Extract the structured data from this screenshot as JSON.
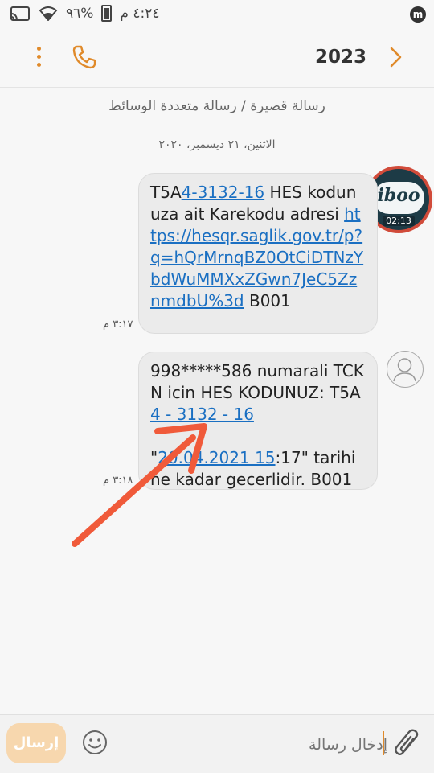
{
  "status_bar": {
    "time": "٤:٢٤ م",
    "battery": "%٩٦"
  },
  "header": {
    "title": "2023"
  },
  "conversation": {
    "type_label": "رسالة قصيرة / رسالة متعددة الوسائط",
    "date_label": "الاثنين، ٢١ ديسمبر، ٢٠٢٠"
  },
  "messages": [
    {
      "parts": [
        "T5A",
        "4-3132-16",
        " HES kodunuza ait Karekodu adresi ",
        "https://hesqr.saglik.gov.tr/p?q=hQrMrnqBZ0OtCiDTNzYbdWuMMXxZGwn7JeC5ZznmdbU%3d",
        " B001"
      ],
      "time": "٣:١٧ م"
    },
    {
      "parts": [
        "998*****586 numarali TCKN icin HES KODUNUZ: T5A",
        "4 - 3132 - 16",
        "\"",
        "20.04.2021 15",
        ":17\" tarihine kadar gecerlidir. B001"
      ],
      "time": "٣:١٨ م"
    }
  ],
  "avatar": {
    "logo_text": "iboo",
    "duration": "02:13"
  },
  "input_bar": {
    "placeholder": "إدخال رسالة",
    "send_label": "إرسال"
  },
  "colors": {
    "accent": "#e08a2a",
    "link": "#1a6fc2",
    "arrow": "#f05a3a",
    "bubble": "#ebebeb"
  }
}
